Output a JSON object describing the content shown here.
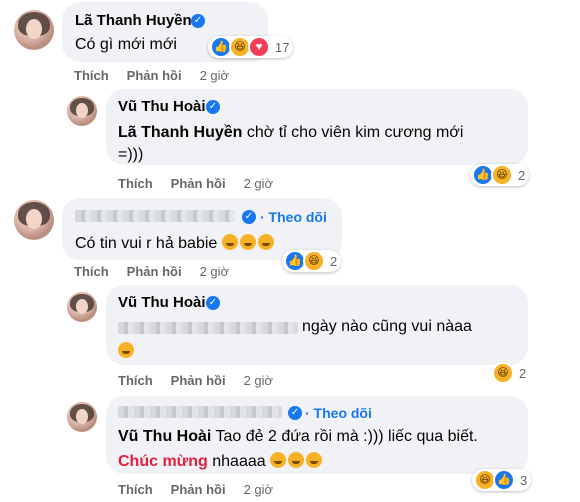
{
  "colors": {
    "link": "#1877f2",
    "muted": "#65676b",
    "bubble": "#f0f2f5",
    "highlight": "#e41e3f"
  },
  "icons": {
    "verified": "verified-badge-icon",
    "like": "like-reaction-icon",
    "haha": "haha-reaction-icon",
    "love": "love-reaction-icon"
  },
  "actions": {
    "like": "Thích",
    "reply": "Phản hồi"
  },
  "comments": [
    {
      "author": "Lã Thanh Huyền",
      "text": "Có gì mới mới",
      "time": "2 giờ",
      "reactions": [
        "like",
        "haha",
        "love"
      ],
      "reaction_count": "17"
    },
    {
      "author": "Vũ Thu Hoài",
      "mention": "Lã Thanh Huyền",
      "text_after_mention": " chờ tỉ cho viên kim cương mới",
      "text_line2": "=)))",
      "time": "2 giờ",
      "reactions": [
        "like",
        "haha"
      ],
      "reaction_count": "2"
    },
    {
      "follow": "· Theo dõi",
      "text": "Có tin vui r hả babie",
      "time": "2 giờ",
      "reactions": [
        "like",
        "haha"
      ],
      "reaction_count": "2"
    },
    {
      "author": "Vũ Thu Hoài",
      "text_visible": "ngày nào cũng vui nàaa",
      "time": "2 giờ",
      "reactions": [
        "haha"
      ],
      "reaction_count": "2"
    },
    {
      "follow": "· Theo dõi",
      "mention": "Vũ Thu Hoài",
      "text_after_mention": " Tao đẻ 2 đứa rồi mà :))) liếc qua biết.",
      "highlight": "Chúc mừng",
      "text_line2_after": " nhaaaa",
      "time": "2 giờ",
      "reactions": [
        "haha",
        "like"
      ],
      "reaction_count": "3"
    }
  ]
}
